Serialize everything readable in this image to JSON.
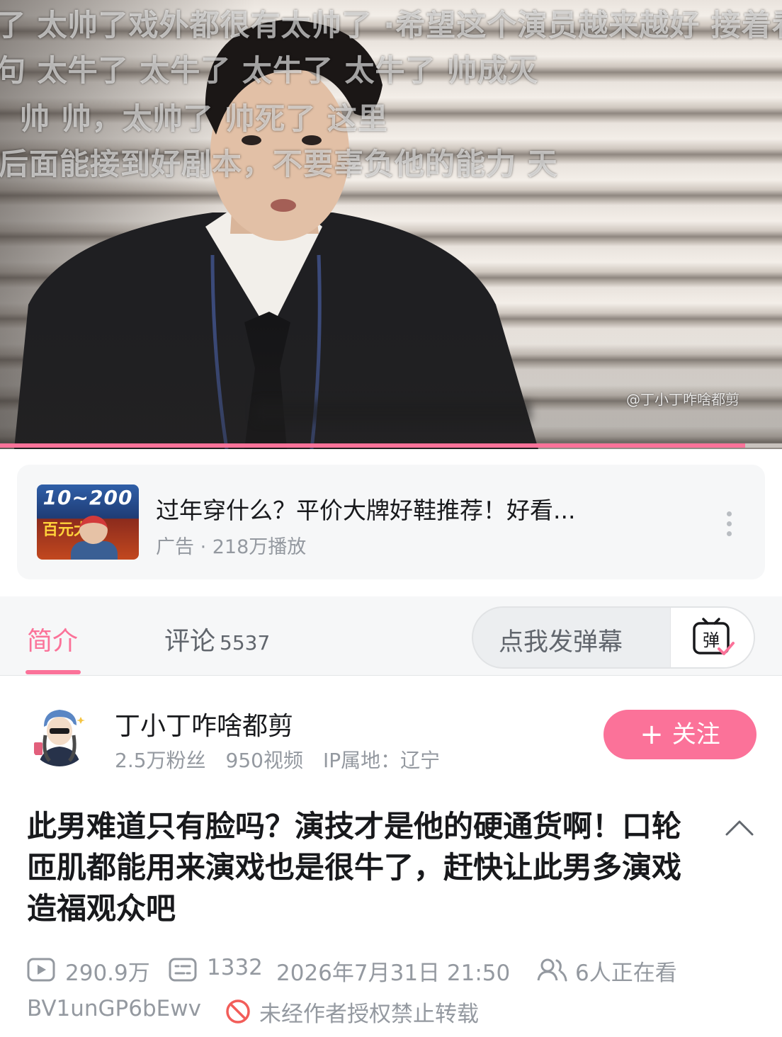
{
  "player": {
    "danmaku": [
      "了  太帅了戏外都很有太帅了  ·希望这个演员越来越好  接着看",
      "句    太牛了  太牛了  太牛了  太牛了                                    帅成灭",
      "帅          帅，太帅了                                    帅死了  这里",
      "后面能接到好剧本，不要辜负他的能力                                                    天"
    ],
    "watermark": "@丁小丁咋啥都剪",
    "progress_fraction": 0.953
  },
  "ad": {
    "thumb_text_top": "10~200",
    "thumb_text_mid": "百元大",
    "title": "过年穿什么？平价大牌好鞋推荐！好看...",
    "meta": "广告 · 218万播放",
    "more_icon": "more-vertical-icon"
  },
  "tabs": {
    "intro_label": "简介",
    "comments_label": "评论",
    "comments_count": "5537",
    "danmaku_placeholder": "点我发弹幕",
    "danmaku_icon_text": "弹"
  },
  "uploader": {
    "name": "丁小丁咋啥都剪",
    "fans": "2.5万粉丝",
    "videos": "950视频",
    "ip": "IP属地：辽宁",
    "follow_label": "关注",
    "follow_plus": "+"
  },
  "video": {
    "title": "此男难道只有脸吗？演技才是他的硬通货啊！口轮匝肌都能用来演戏也是很牛了，赶快让此男多演戏造福观众吧",
    "views": "290.9万",
    "danmaku_count": "1332",
    "datetime": "2026年7月31日 21:50",
    "watching": "6人正在看",
    "bvid": "BV1unGP6bEwv",
    "no_repost": "未经作者授权禁止转载"
  },
  "colors": {
    "accent": "#fb7299",
    "text_primary": "#18191c",
    "text_secondary": "#9499a0",
    "warning_red": "#f25d59"
  }
}
